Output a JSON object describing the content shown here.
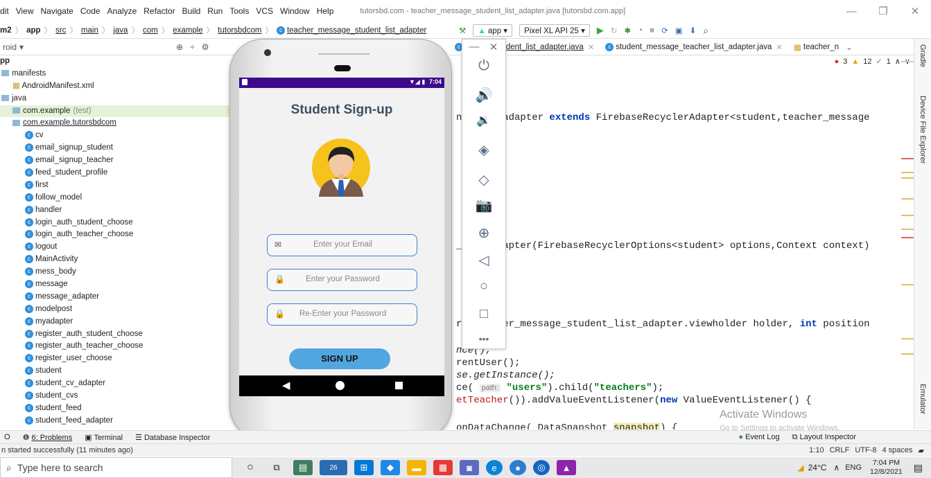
{
  "menu": {
    "items": [
      "dit",
      "View",
      "Navigate",
      "Code",
      "Analyze",
      "Refactor",
      "Build",
      "Run",
      "Tools",
      "VCS",
      "Window",
      "Help"
    ],
    "window_title": "tutorsbd.com - teacher_message_student_list_adapter.java [tutorsbd.com.app]"
  },
  "breadcrumb": {
    "items": [
      "m2",
      "app",
      "src",
      "main",
      "java",
      "com",
      "example",
      "tutorsbdcom"
    ],
    "current_file": "teacher_message_student_list_adapter"
  },
  "run_toolbar": {
    "config": "app",
    "device": "Pixel XL API 25"
  },
  "project": {
    "view_selector": "roid",
    "root": "pp",
    "items": [
      {
        "label": "manifests",
        "type": "folder",
        "level": 0
      },
      {
        "label": "AndroidManifest.xml",
        "type": "manifest",
        "level": 1
      },
      {
        "label": "java",
        "type": "folder",
        "level": 0
      },
      {
        "label": "com.example",
        "suffix": "(test)",
        "type": "package",
        "level": 1,
        "selected": true
      },
      {
        "label": "com.example.tutorsbdcom",
        "type": "package",
        "level": 1
      },
      {
        "label": "cv",
        "type": "class",
        "level": 2
      },
      {
        "label": "email_signup_student",
        "type": "class",
        "level": 2
      },
      {
        "label": "email_signup_teacher",
        "type": "class",
        "level": 2
      },
      {
        "label": "feed_student_profile",
        "type": "class",
        "level": 2
      },
      {
        "label": "first",
        "type": "class",
        "level": 2
      },
      {
        "label": "follow_model",
        "type": "class",
        "level": 2
      },
      {
        "label": "handler",
        "type": "class",
        "level": 2
      },
      {
        "label": "login_auth_student_choose",
        "type": "class",
        "level": 2
      },
      {
        "label": "login_auth_teacher_choose",
        "type": "class",
        "level": 2
      },
      {
        "label": "logout",
        "type": "class",
        "level": 2
      },
      {
        "label": "MainActivity",
        "type": "class",
        "level": 2
      },
      {
        "label": "mess_body",
        "type": "class",
        "level": 2
      },
      {
        "label": "message",
        "type": "class",
        "level": 2
      },
      {
        "label": "message_adapter",
        "type": "class",
        "level": 2
      },
      {
        "label": "modelpost",
        "type": "class",
        "level": 2
      },
      {
        "label": "myadapter",
        "type": "class",
        "level": 2
      },
      {
        "label": "register_auth_student_choose",
        "type": "class",
        "level": 2
      },
      {
        "label": "register_auth_teacher_choose",
        "type": "class",
        "level": 2
      },
      {
        "label": "register_user_choose",
        "type": "class",
        "level": 2
      },
      {
        "label": "student",
        "type": "class",
        "level": 2
      },
      {
        "label": "student_cv_adapter",
        "type": "class",
        "level": 2
      },
      {
        "label": "student_cvs",
        "type": "class",
        "level": 2
      },
      {
        "label": "student_feed",
        "type": "class",
        "level": 2
      },
      {
        "label": "student_feed_adapter",
        "type": "class",
        "level": 2
      }
    ]
  },
  "tabs": {
    "items": [
      {
        "label": "essage_student_list_adapter.java",
        "active": true
      },
      {
        "label": "student_message_teacher_list_adapter.java",
        "active": false
      },
      {
        "label": "teacher_n",
        "active": false
      }
    ]
  },
  "inspections": {
    "errors": "3",
    "warnings": "12",
    "weak": "1"
  },
  "code": {
    "line1a": "nt_list_adapter ",
    "line1kw": "extends",
    "line1b": " FirebaseRecyclerAdapter<student,teacher_message",
    "line2": "_list_adapter(FirebaseRecyclerOptions<student> options,Context context)",
    "line3a": "r( teacher_message_student_list_adapter.viewholder holder, ",
    "line3kw": "int",
    "line3b": " position",
    "line4": "nce();",
    "line5": "rentUser();",
    "line6": "se.getInstance();",
    "line7_pre": "ce( ",
    "line7_hint": "path:",
    "line7_str1": "\"users\"",
    "line7_mid": ").child(",
    "line7_str2": "\"teachers\"",
    "line7_post": ");",
    "line8_red": "etTeacher",
    "line8_a": "()).addValueEventListener(",
    "line8_kw": "new",
    "line8_b": " ValueEventListener() {",
    "line9_a": "onDataChange( DataSnapshot ",
    "line9_hl": "snapshot",
    "line9_b": ") {"
  },
  "right_strip": {
    "gradle": "Gradle",
    "device_explorer": "Device File Explorer",
    "emulator": "Emulator"
  },
  "watermark": {
    "line1": "Activate Windows",
    "line2": "Go to Settings to activate Windows."
  },
  "app_screen": {
    "status_time": "7:04",
    "title": "Student Sign-up",
    "email_placeholder": "Enter your Email",
    "password_placeholder": "Enter your Password",
    "reenter_placeholder": "Re-Enter your Password",
    "signup_button": "SIGN UP"
  },
  "emulator_controls": [
    "power",
    "volume-up",
    "volume-down",
    "rotate-left",
    "rotate-right",
    "screenshot",
    "zoom",
    "back",
    "home",
    "overview",
    "more"
  ],
  "bottom_tools": {
    "run_fragment": "O",
    "problems": "6: Problems",
    "terminal": "Terminal",
    "db_inspector": "Database Inspector",
    "event_log": "Event Log",
    "layout_inspector": "Layout Inspector"
  },
  "status_line": {
    "message": "n started successfully (11 minutes ago)",
    "position": "1:10",
    "line_sep": "CRLF",
    "encoding": "UTF-8",
    "indent": "4 spaces"
  },
  "taskbar": {
    "search_placeholder": "Type here to search",
    "badge": "26",
    "weather": "24°C",
    "lang": "ENG",
    "time": "7:04 PM",
    "date": "12/8/2021"
  }
}
